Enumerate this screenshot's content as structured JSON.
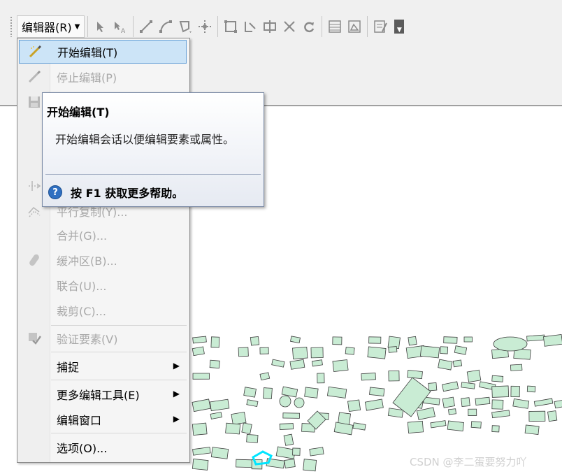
{
  "toolbar": {
    "editor_menu_label": "编辑器(R)",
    "icons": [
      "edit-tool-icon",
      "edit-annotation-icon",
      "straight-segment-icon",
      "end-point-arc-icon",
      "trace-icon",
      "midpoint-icon",
      "edit-vertices-icon",
      "reshape-feature-icon",
      "cut-polygons-icon",
      "split-tool-icon",
      "rotate-icon",
      "attributes-icon",
      "sketch-properties-icon",
      "create-features-icon"
    ]
  },
  "menu": {
    "items": [
      {
        "label": "开始编辑(T)",
        "state": "highlighted",
        "icon": "start-editing-icon"
      },
      {
        "label": "停止编辑(P)",
        "state": "disabled",
        "icon": "stop-editing-icon"
      },
      {
        "label": "平行复制(Y)...",
        "state": "disabled",
        "icon": "copy-parallel-icon"
      },
      {
        "label": "合并(G)...",
        "state": "disabled",
        "icon": ""
      },
      {
        "label": "缓冲区(B)...",
        "state": "disabled",
        "icon": "buffer-icon"
      },
      {
        "label": "联合(U)...",
        "state": "disabled",
        "icon": ""
      },
      {
        "label": "裁剪(C)...",
        "state": "disabled",
        "icon": ""
      },
      {
        "label": "验证要素(V)",
        "state": "disabled",
        "icon": "validate-features-icon"
      },
      {
        "label": "捕捉",
        "state": "submenu",
        "icon": ""
      },
      {
        "label": "更多编辑工具(E)",
        "state": "submenu",
        "icon": ""
      },
      {
        "label": "编辑窗口",
        "state": "submenu",
        "icon": ""
      },
      {
        "label": "选项(O)...",
        "state": "normal",
        "icon": ""
      }
    ]
  },
  "tooltip": {
    "title": "开始编辑(T)",
    "body": "开始编辑会话以便编辑要素或属性。",
    "help_key": "F1",
    "help_text": "按 F1 获取更多帮助。"
  },
  "watermark": "CSDN @李二蛋要努力吖",
  "colors": {
    "map_feature_fill": "#c9ecd4",
    "map_feature_stroke": "#3d3d3d",
    "selected_feature_stroke": "#00e5ff",
    "menu_highlight": "#cce4f7",
    "help_icon": "#2f6fc1"
  }
}
